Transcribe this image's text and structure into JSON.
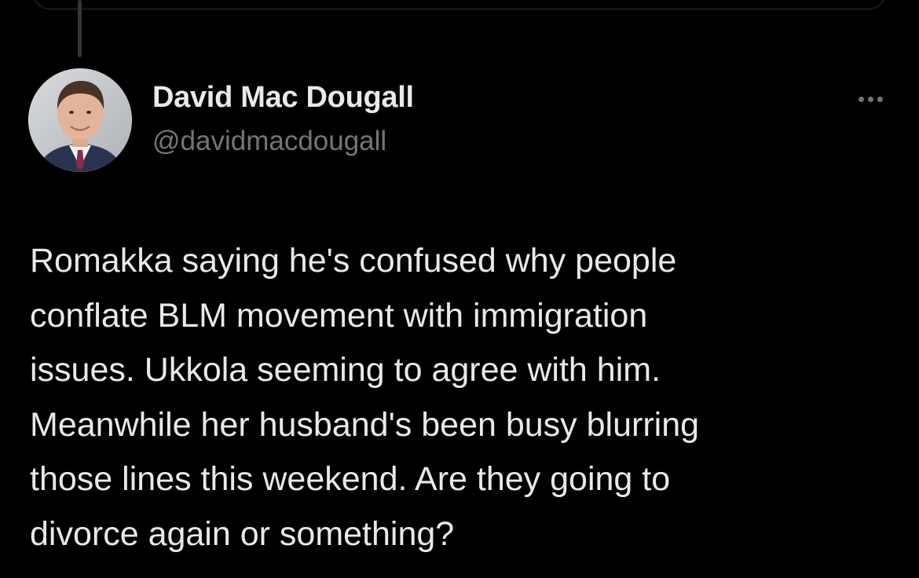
{
  "colors": {
    "background": "#000000",
    "primary_text": "#e7e9ea",
    "secondary_text": "#71767b",
    "border": "#2f3336",
    "thread_line": "#333639"
  },
  "post": {
    "author": {
      "display_name": "David Mac Dougall",
      "handle": "@davidmacdougall",
      "avatar_icon": "profile-photo"
    },
    "more_icon": "more-horizontal-icon",
    "text": "Romakka saying he's confused why people\nconflate BLM movement with immigration\nissues. Ukkola seeming to agree with him.\nMeanwhile her husband's been busy blurring\nthose lines this weekend. Are they going to\ndivorce again or something?"
  }
}
